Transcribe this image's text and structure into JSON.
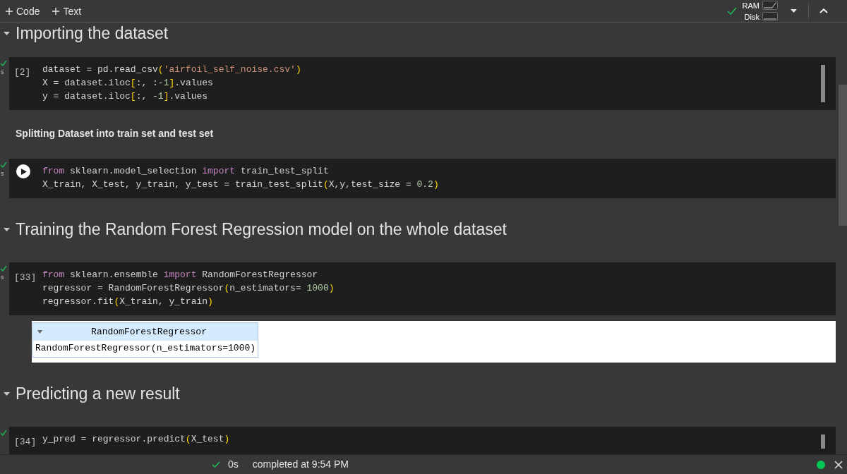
{
  "toolbar": {
    "buttons": [
      {
        "label": "Code"
      },
      {
        "label": "Text"
      }
    ],
    "connected": true,
    "resources": [
      {
        "label": "RAM",
        "kind": "ram"
      },
      {
        "label": "Disk",
        "kind": "disk"
      }
    ]
  },
  "cells": [
    {
      "kind": "heading",
      "text": "Importing the dataset"
    },
    {
      "kind": "code",
      "executed": true,
      "run_time": "s",
      "run_button": false,
      "prompt": "[2]",
      "scrollbar": true,
      "lines": [
        [
          {
            "text": "dataset = pd.read_csv",
            "kind": "plain"
          },
          {
            "text": "(",
            "kind": "bracket"
          },
          {
            "text": "'airfoil_self_noise.csv'",
            "kind": "string"
          },
          {
            "text": ")",
            "kind": "bracket"
          }
        ],
        [
          {
            "text": "X = dataset.iloc",
            "kind": "plain"
          },
          {
            "text": "[",
            "kind": "bracket"
          },
          {
            "text": ":, :-",
            "kind": "plain"
          },
          {
            "text": "1",
            "kind": "number"
          },
          {
            "text": "]",
            "kind": "bracket"
          },
          {
            "text": ".values",
            "kind": "plain"
          }
        ],
        [
          {
            "text": "y = dataset.iloc",
            "kind": "plain"
          },
          {
            "text": "[",
            "kind": "bracket"
          },
          {
            "text": ":, -",
            "kind": "plain"
          },
          {
            "text": "1",
            "kind": "number"
          },
          {
            "text": "]",
            "kind": "bracket"
          },
          {
            "text": ".values",
            "kind": "plain"
          }
        ]
      ]
    },
    {
      "kind": "text",
      "text": "Splitting Dataset into train set and test set"
    },
    {
      "kind": "code",
      "executed": true,
      "run_time": "s",
      "run_button": true,
      "scrollbar": false,
      "lines": [
        [
          {
            "text": "from",
            "kind": "keyword"
          },
          {
            "text": " sklearn.model_selection ",
            "kind": "plain"
          },
          {
            "text": "import",
            "kind": "keyword"
          },
          {
            "text": " train_test_split",
            "kind": "plain"
          }
        ],
        [
          {
            "text": "X_train, X_test, y_train, y_test = train_test_split",
            "kind": "plain"
          },
          {
            "text": "(",
            "kind": "bracket"
          },
          {
            "text": "X,y,test_size = ",
            "kind": "plain"
          },
          {
            "text": "0.2",
            "kind": "number"
          },
          {
            "text": ")",
            "kind": "bracket"
          }
        ]
      ]
    },
    {
      "kind": "heading",
      "text": "Training the Random Forest Regression model on the whole dataset"
    },
    {
      "kind": "code",
      "executed": true,
      "run_time": "s",
      "run_button": false,
      "prompt": "[33]",
      "scrollbar": false,
      "lines": [
        [
          {
            "text": "from",
            "kind": "keyword"
          },
          {
            "text": " sklearn.ensemble ",
            "kind": "plain"
          },
          {
            "text": "import",
            "kind": "keyword"
          },
          {
            "text": " RandomForestRegressor",
            "kind": "plain"
          }
        ],
        [
          {
            "text": "regressor = RandomForestRegressor",
            "kind": "plain"
          },
          {
            "text": "(",
            "kind": "bracket"
          },
          {
            "text": "n_estimators= ",
            "kind": "plain"
          },
          {
            "text": "1000",
            "kind": "number"
          },
          {
            "text": ")",
            "kind": "bracket"
          }
        ],
        [
          {
            "text": "regressor.fit",
            "kind": "plain"
          },
          {
            "text": "(",
            "kind": "bracket"
          },
          {
            "text": "X_train, y_train",
            "kind": "plain"
          },
          {
            "text": ")",
            "kind": "bracket"
          }
        ]
      ],
      "output": {
        "title": "RandomForestRegressor",
        "expanded": true,
        "params": "RandomForestRegressor(n_estimators=1000)"
      }
    },
    {
      "kind": "heading",
      "text": "Predicting a new result"
    },
    {
      "kind": "code",
      "executed": true,
      "run_button": false,
      "prompt": "[34]",
      "scrollbar": true,
      "lines": [
        [
          {
            "text": "y_pred = regressor.predict",
            "kind": "plain"
          },
          {
            "text": "(",
            "kind": "bracket"
          },
          {
            "text": "X_test",
            "kind": "plain"
          },
          {
            "text": ")",
            "kind": "bracket"
          }
        ]
      ]
    }
  ],
  "status_bar": {
    "succeeded": true,
    "duration": "0s",
    "message": "completed at 9:54 PM",
    "connected": true
  }
}
